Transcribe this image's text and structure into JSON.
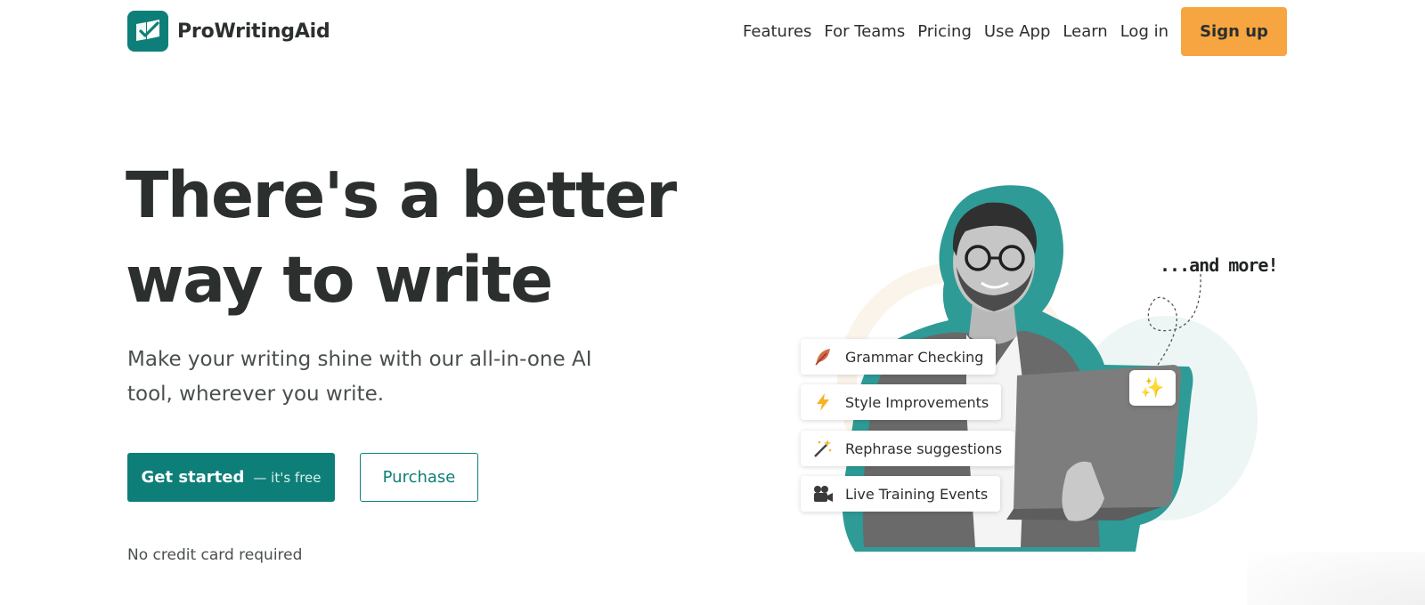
{
  "brand": {
    "name": "ProWritingAid",
    "accent": "#0e7f78",
    "cta": "#f7a541"
  },
  "nav": {
    "items": [
      {
        "label": "Features"
      },
      {
        "label": "For Teams"
      },
      {
        "label": "Pricing"
      },
      {
        "label": "Use App"
      },
      {
        "label": "Learn"
      },
      {
        "label": "Log in"
      }
    ],
    "signup": "Sign up"
  },
  "hero": {
    "title_line1": "There's a better",
    "title_line2": "way to write",
    "subtitle": "Make your writing shine with our all-in-one AI tool, wherever you write.",
    "primary_button": "Get started",
    "primary_button_suffix": "— it's free",
    "secondary_button": "Purchase",
    "note": "No credit card required"
  },
  "illustration": {
    "callout": "...and more!",
    "features": [
      {
        "label": "Grammar Checking",
        "icon": "feather-icon"
      },
      {
        "label": "Style Improvements",
        "icon": "lightning-icon"
      },
      {
        "label": "Rephrase suggestions",
        "icon": "magic-wand-icon"
      },
      {
        "label": "Live Training Events",
        "icon": "video-camera-icon"
      }
    ]
  }
}
